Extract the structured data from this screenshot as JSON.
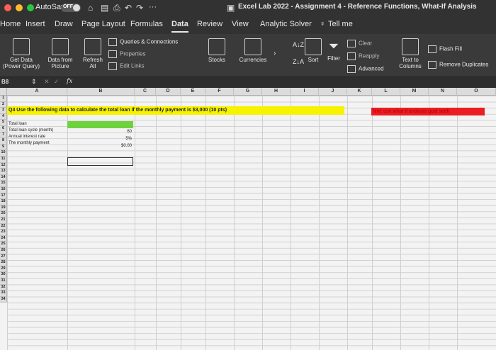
{
  "titlebar": {
    "autosave_label": "AutoSave",
    "autosave_state": "OFF",
    "more_label": "···",
    "document_title": "Excel Lab 2022 - Assignment 4 - Reference Functions, What-If Analysis"
  },
  "tabs": [
    "Home",
    "Insert",
    "Draw",
    "Page Layout",
    "Formulas",
    "Data",
    "Review",
    "View",
    "Analytic Solver",
    "Tell me"
  ],
  "active_tab": "Data",
  "ribbon": {
    "get_data": "Get Data (Power Query)",
    "data_from_picture": "Data from Picture",
    "refresh_all": "Refresh All",
    "queries_connections": "Queries & Connections",
    "properties": "Properties",
    "edit_links": "Edit Links",
    "stocks": "Stocks",
    "currencies": "Currencies",
    "sort": "Sort",
    "filter": "Filter",
    "clear": "Clear",
    "reapply": "Reapply",
    "advanced": "Advanced",
    "text_to_columns": "Text to Columns",
    "flash_fill": "Flash Fill",
    "remove_duplicates": "Remove Duplicates"
  },
  "formula_bar": {
    "name_box": "B8",
    "fx": "fx",
    "content": ""
  },
  "columns": [
    "A",
    "B",
    "C",
    "D",
    "E",
    "F",
    "G",
    "H",
    "I",
    "J",
    "K",
    "L",
    "M",
    "N",
    "O"
  ],
  "rows": [
    "1",
    "2",
    "3",
    "4",
    "5",
    "6",
    "7",
    "8",
    "9",
    "10",
    "11",
    "12",
    "13",
    "14",
    "15",
    "16",
    "17",
    "18",
    "19",
    "20",
    "21",
    "22",
    "23",
    "24",
    "25",
    "26",
    "27",
    "28",
    "29",
    "30",
    "31",
    "32",
    "33",
    "34"
  ],
  "sheet": {
    "question": "Q4 Use the following data to calculate the total loan if the monthly payment is $3,000 (10 pts)",
    "hint": "hint: use what-if analysis goal seek",
    "labels": [
      "Total loan",
      "Total loan cycle (month)",
      "Annual interest rate",
      "The monthly payment"
    ],
    "values": [
      "",
      "60",
      "5%",
      "$0.00"
    ]
  },
  "colors": {
    "question_fill": "#f7f200",
    "hint_fill": "#ea1c24",
    "hint_text": "#b00000",
    "input_fill": "#6ed23c"
  }
}
